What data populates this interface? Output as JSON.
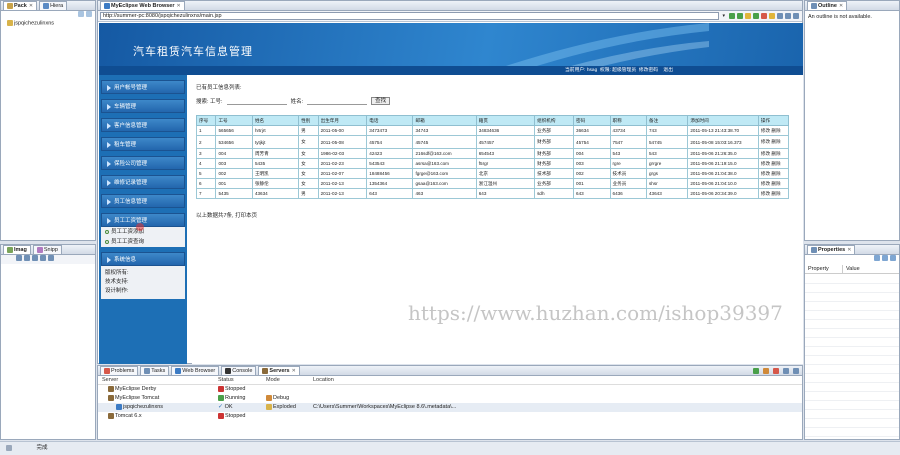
{
  "left_top": {
    "tabs": [
      {
        "label": "Pack"
      },
      {
        "label": "Hiera"
      }
    ],
    "tree_item": "jspqichezulinxns"
  },
  "left_bottom": {
    "tabs": [
      {
        "label": "Imag"
      },
      {
        "label": "Snipp"
      }
    ]
  },
  "browser": {
    "tab_label": "MyEclipse Web Browser",
    "url": "http://summer-pc:8080/jspqichezulinxns/main.jsp"
  },
  "app": {
    "title": "汽车租赁汽车信息管理",
    "top_links": [
      "当前用户: hsag",
      "权限: 超级管理员",
      "修改密码",
      "退出"
    ],
    "nav_items": [
      "用户帐号管理",
      "车辆管理",
      "客户信息管理",
      "租车管理",
      "保险公司管理",
      "维修记录管理",
      "员工信息管理",
      "员工工资管理"
    ],
    "sub_items": [
      "员工工资添加",
      "员工工资查询"
    ],
    "nav_after": "系统信息",
    "info_lines": [
      "版权所有:",
      "技术支持:",
      "设计制作:"
    ],
    "list_title": "已有员工信息列表:",
    "search": {
      "label_number": "搜索: 工号:",
      "label_name": "姓名:",
      "button": "查找"
    },
    "columns": [
      "序号",
      "工号",
      "姓名",
      "性别",
      "出生年月",
      "电话",
      "邮箱",
      "籍贯",
      "组织机构",
      "密码",
      "职称",
      "备注",
      "添加时间",
      "操作"
    ],
    "rows": [
      [
        "1",
        "565656",
        "hrtrjrt",
        "男",
        "2011-05-00",
        "3473473",
        "34743",
        "34834636",
        "业务部",
        "36634",
        "43734",
        "743",
        "2011-05-13 21:43:38.70",
        "修改 删除"
      ],
      [
        "2",
        "534656",
        "tytjkjt",
        "女",
        "2011-05-08",
        "45754",
        "45745",
        "457457",
        "财务部",
        "45754",
        "7547",
        "54745",
        "2011-05-08 15:03:16.373",
        "修改 删除"
      ],
      [
        "3",
        "004",
        "周芳青",
        "女",
        "1986-02-03",
        "42423",
        "216sdf@163.com",
        "654543",
        "财务部",
        "004",
        "543",
        "543",
        "2011-05-06 21:26:35.0",
        "修改 删除"
      ],
      [
        "4",
        "003",
        "5435",
        "女",
        "2011-02-23",
        "543543",
        "asrsa@163.com",
        "f5rgr",
        "财务部",
        "003",
        "rgre",
        "grrgre",
        "2011-05-06 21:19:15.0",
        "修改 删除"
      ],
      [
        "5",
        "002",
        "王明凯",
        "女",
        "2011-02-07",
        "18488456",
        "fgrge@163.com",
        "北京",
        "技术部",
        "002",
        "技术员",
        "grgs",
        "2011-05-06 21:04:38.0",
        "修改 删除"
      ],
      [
        "6",
        "001",
        "张静伦",
        "女",
        "2011-02-13",
        "1354364",
        "gsaa@163.com",
        "浙江温州",
        "业务部",
        "001",
        "业务员",
        "shsr",
        "2011-05-06 21:04:10.0",
        "修改 删除"
      ],
      [
        "7",
        "5435",
        "43634",
        "男",
        "2011-02-13",
        "643",
        "463",
        "643",
        "sdh",
        "643",
        "6436",
        "43643",
        "2011-05-06 20:34:39.0",
        "修改 删除"
      ]
    ],
    "footer": "以上数据共7条, 打印本页"
  },
  "watermark": "https://www.huzhan.com/ishop39397",
  "outline": {
    "tab": "Outline",
    "message": "An outline is not available."
  },
  "properties": {
    "tab": "Properties",
    "col_property": "Property",
    "col_value": "Value"
  },
  "bottom": {
    "tabs": [
      {
        "label": "Problems"
      },
      {
        "label": "Tasks"
      },
      {
        "label": "Web Browser"
      },
      {
        "label": "Console"
      },
      {
        "label": "Servers"
      }
    ],
    "headers": [
      "Server",
      "Status",
      "Mode",
      "Location"
    ],
    "servers": [
      {
        "name": "MyEclipse Derby",
        "status": "Stopped",
        "mode": "",
        "location": ""
      },
      {
        "name": "MyEclipse Tomcat",
        "status": "Running",
        "mode": "Debug",
        "location": ""
      },
      {
        "name": "jspqichezulinxns",
        "status": "OK",
        "mode": "Exploded",
        "location": "C:\\Users\\Summer\\Workspaces\\MyEclipse 8.6\\.metadata\\..."
      },
      {
        "name": "Tomcat 6.x",
        "status": "Stopped",
        "mode": "",
        "location": ""
      }
    ]
  },
  "statusbar": {
    "text": "完成"
  },
  "colors": {
    "brand": "#1d6fb5",
    "nav": "#2366ad",
    "table_header": "#bfe9f5"
  }
}
